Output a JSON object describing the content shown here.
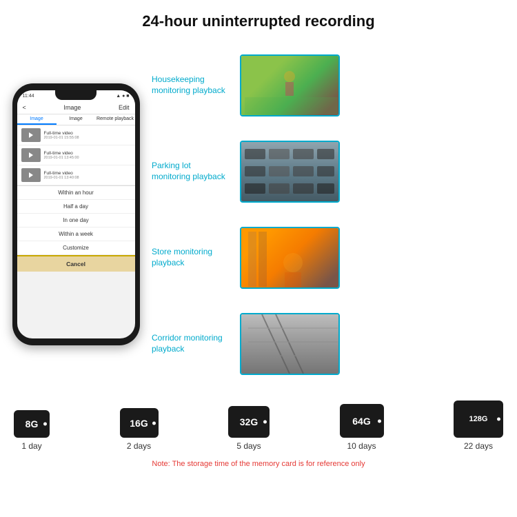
{
  "title": "24-hour uninterrupted recording",
  "phone": {
    "status_time": "11:44",
    "nav_back": "<",
    "nav_title": "Image",
    "nav_edit": "Edit",
    "tabs": [
      "Image",
      "Image",
      "Remote playback"
    ],
    "list_items": [
      {
        "label": "Full-time video",
        "date": "2019-01-01 15:55:08"
      },
      {
        "label": "Full-time video",
        "date": "2019-01-01 13:45:00"
      },
      {
        "label": "Full-time video",
        "date": "2019-01-01 13:40:08"
      }
    ],
    "dropdown_items": [
      "Within an hour",
      "Half a day",
      "In one day",
      "Within a week",
      "Customize"
    ],
    "cancel_label": "Cancel"
  },
  "monitoring": [
    {
      "label": "Housekeeping\nmonitoring playback",
      "img": "housekeeping"
    },
    {
      "label": "Parking lot\nmonitoring playback",
      "img": "parking"
    },
    {
      "label": "Store monitoring\nplayback",
      "img": "store"
    },
    {
      "label": "Corridor monitoring\nplayback",
      "img": "corridor"
    }
  ],
  "storage": {
    "cards": [
      {
        "size": "8G",
        "days": "1 day",
        "css": "sd-card-size-8g"
      },
      {
        "size": "16G",
        "days": "2 days",
        "css": "sd-card-size-16g"
      },
      {
        "size": "32G",
        "days": "5 days",
        "css": "sd-card-size-32g"
      },
      {
        "size": "64G",
        "days": "10 days",
        "css": "sd-card-size-64g"
      },
      {
        "size": "128G",
        "days": "22 days",
        "css": "sd-card-size-128g"
      }
    ],
    "note": "Note: The storage time of the memory card is for reference only"
  }
}
